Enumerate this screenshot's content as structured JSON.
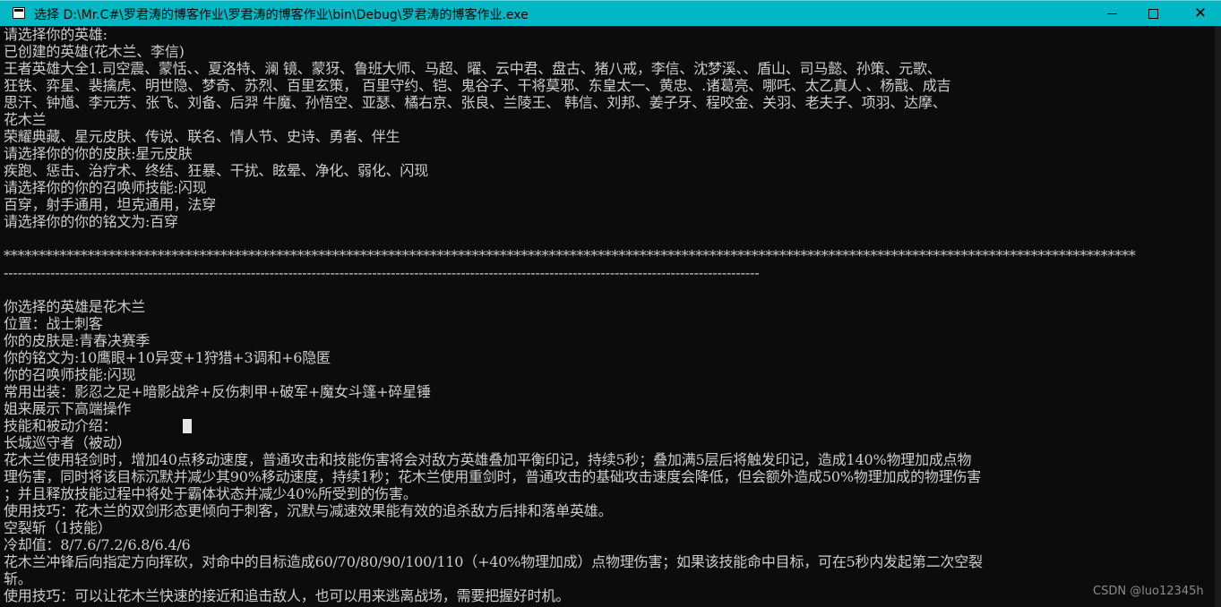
{
  "window": {
    "title": "选择 D:\\Mr.C#\\罗君涛的博客作业\\罗君涛的博客作业\\bin\\Debug\\罗君涛的博客作业.exe",
    "buttons": {
      "minimize": "minimize-icon",
      "maximize": "maximize-icon",
      "close": "✕"
    }
  },
  "console": {
    "lines": [
      "请选择你的英雄:",
      "已创建的英雄(花木兰、李信)",
      "王者英雄大全1.司空震、蒙恬、、夏洛特、澜 镜、蒙犽、鲁班大师、马超、曜、云中君、盘古、猪八戒，李信、沈梦溪、、盾山、司马懿、孙策、元歌、",
      "狂铁、弈星、裴擒虎、明世隐、梦奇、苏烈、百里玄策， 百里守约、铠、鬼谷子、干将莫邪、东皇太一、黄忠、.诸葛亮、哪吒、太乙真人 、杨戬、成吉",
      "思汗、钟馗、李元芳、张飞、刘备、后羿 牛魔、孙悟空、亚瑟、橘右京、张良、兰陵王、 韩信、刘邦、姜子牙、程咬金、关羽、老夫子、项羽、达摩、",
      "花木兰",
      "荣耀典藏、星元皮肤、传说、联名、情人节、史诗、勇者、伴生",
      "请选择你的你的皮肤:星元皮肤",
      "疾跑、惩击、治疗术、终结、狂暴、干扰、眩晕、净化、弱化、闪现",
      "请选择你的你的召唤师技能:闪现",
      "百穿，射手通用，坦克通用，法穿",
      "请选择你的你的铭文为:百穿",
      "",
      "******************************************************************************************************************************************************************",
      "------------------------------------------------------------------------------------------------------------------------------------------------------------------",
      "",
      "你选择的英雄是花木兰",
      "位置：战士刺客",
      "你的皮肤是:青春决赛季",
      "你的铭文为:10鹰眼+10异变+1狩猎+3调和+6隐匿",
      "你的召唤师技能:闪现",
      "常用出装：影忍之足+暗影战斧+反伤刺甲+破军+魔女斗篷+碎星锤",
      "姐来展示下高端操作",
      "技能和被动介绍：",
      "长城巡守者（被动）",
      "花木兰使用轻剑时，增加40点移动速度，普通攻击和技能伤害将会对敌方英雄叠加平衡印记，持续5秒；叠加满5层后将触发印记，造成140%物理加成点物",
      "理伤害，同时将该目标沉默并减少其90%移动速度，持续1秒；花木兰使用重剑时，普通攻击的基础攻击速度会降低，但会额外造成50%物理加成的物理伤害",
      "；并且释放技能过程中将处于霸体状态并减少40%所受到的伤害。",
      "使用技巧：花木兰的双剑形态更倾向于刺客，沉默与减速效果能有效的追杀敌方后排和落单英雄。",
      "空裂斩（1技能）",
      "冷却值：8/7.6/7.2/6.8/6.4/6",
      "花木兰冲锋后向指定方向挥砍，对命中的目标造成60/70/80/90/100/110（+40%物理加成）点物理伤害；如果该技能命中目标，可在5秒内发起第二次空裂",
      "斩。",
      "使用技巧：可以让花木兰快速的接近和追击敌人，也可以用来逃离战场，需要把握好时机。"
    ]
  },
  "watermark": "CSDN @luo12345h",
  "colors": {
    "titlebar": "#00b7c3",
    "console_bg": "#0c0c0c",
    "console_text": "#cccccc"
  }
}
